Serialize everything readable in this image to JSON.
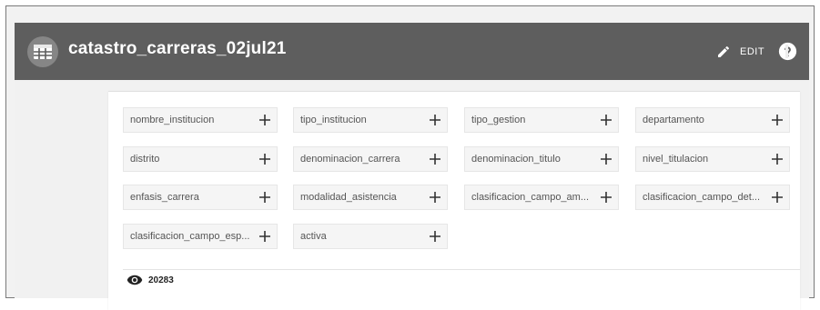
{
  "app": {
    "title": "catastro_carreras_02jul21",
    "edit_label": "EDIT",
    "icons": {
      "app": "table-icon",
      "edit": "pencil-icon",
      "help": "help-circle-icon",
      "add": "plus-icon",
      "views": "eye-icon"
    }
  },
  "fields": [
    {
      "label": "nombre_institucion"
    },
    {
      "label": "tipo_institucion"
    },
    {
      "label": "tipo_gestion"
    },
    {
      "label": "departamento"
    },
    {
      "label": "distrito"
    },
    {
      "label": "denominacion_carrera"
    },
    {
      "label": "denominacion_titulo"
    },
    {
      "label": "nivel_titulacion"
    },
    {
      "label": "enfasis_carrera"
    },
    {
      "label": "modalidad_asistencia"
    },
    {
      "label": "clasificacion_campo_am..."
    },
    {
      "label": "clasificacion_campo_det..."
    },
    {
      "label": "clasificacion_campo_esp..."
    },
    {
      "label": "activa"
    }
  ],
  "footer": {
    "view_count": "20283"
  },
  "colors": {
    "appbar": "#5e5e5e",
    "chip_bg": "#f5f5f5",
    "text": "#555555"
  }
}
